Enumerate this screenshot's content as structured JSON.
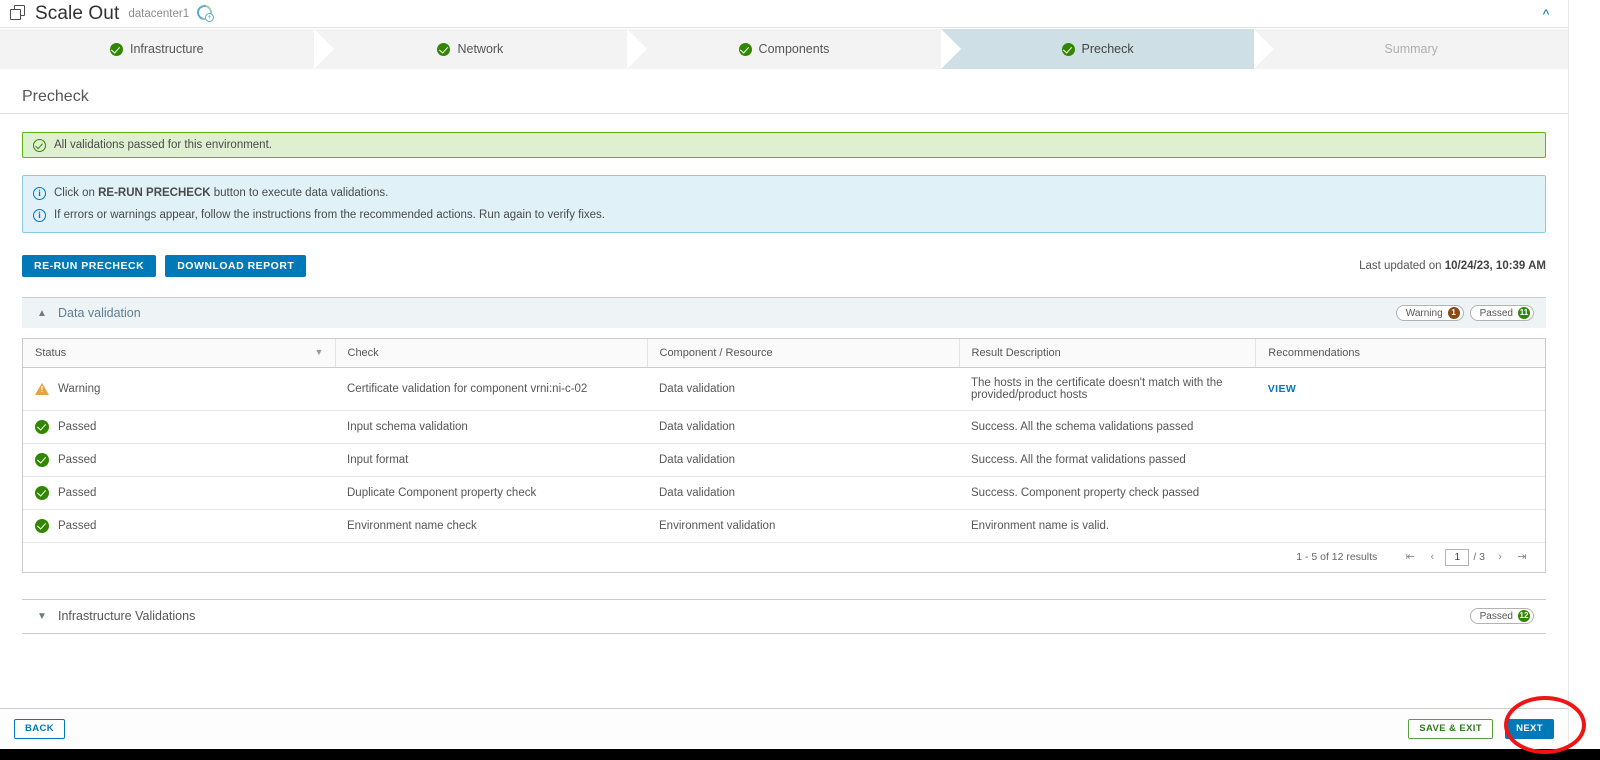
{
  "header": {
    "app_icon": "stacked-squares-icon",
    "title": "Scale Out",
    "subtitle": "datacenter1",
    "env_icon": "environment-add-icon",
    "collapse_icon": "chevron-double-up-icon"
  },
  "stepper": {
    "steps": [
      {
        "label": "Infrastructure",
        "state": "complete"
      },
      {
        "label": "Network",
        "state": "complete"
      },
      {
        "label": "Components",
        "state": "complete"
      },
      {
        "label": "Precheck",
        "state": "active"
      },
      {
        "label": "Summary",
        "state": "disabled"
      }
    ]
  },
  "page": {
    "title": "Precheck"
  },
  "alerts": {
    "success": {
      "icon": "check-circle-icon",
      "text": "All validations passed for this environment."
    },
    "info": {
      "icon": "info-circle-icon",
      "line1_prefix": "Click on ",
      "line1_strong": "RE-RUN PRECHECK",
      "line1_suffix": " button to execute data validations.",
      "line2": "If errors or warnings appear, follow the instructions from the recommended actions. Run again to verify fixes."
    }
  },
  "actions": {
    "rerun_label": "RE-RUN PRECHECK",
    "download_label": "DOWNLOAD REPORT",
    "last_updated_prefix": "Last updated on ",
    "last_updated_value": "10/24/23, 10:39 AM"
  },
  "data_validation": {
    "caret_icon": "chevron-up-icon",
    "title": "Data validation",
    "badges": [
      {
        "label": "Warning",
        "count": "1",
        "tone": "warn"
      },
      {
        "label": "Passed",
        "count": "11",
        "tone": "pass"
      }
    ],
    "columns": [
      "Status",
      "Check",
      "Component / Resource",
      "Result Description",
      "Recommendations"
    ],
    "filter_icon": "funnel-filter-icon",
    "rows": [
      {
        "status": "Warning",
        "status_icon": "warning-triangle-icon",
        "check": "Certificate validation for component vrni:ni-c-02",
        "component": "Data validation",
        "result": "The hosts in the certificate doesn't match with the provided/product hosts",
        "recommendation": "VIEW"
      },
      {
        "status": "Passed",
        "status_icon": "success-check-icon",
        "check": "Input schema validation",
        "component": "Data validation",
        "result": "Success. All the schema validations passed",
        "recommendation": ""
      },
      {
        "status": "Passed",
        "status_icon": "success-check-icon",
        "check": "Input format",
        "component": "Data validation",
        "result": "Success. All the format validations passed",
        "recommendation": ""
      },
      {
        "status": "Passed",
        "status_icon": "success-check-icon",
        "check": "Duplicate Component property check",
        "component": "Data validation",
        "result": "Success. Component property check passed",
        "recommendation": ""
      },
      {
        "status": "Passed",
        "status_icon": "success-check-icon",
        "check": "Environment name check",
        "component": "Environment validation",
        "result": "Environment name is valid.",
        "recommendation": ""
      }
    ],
    "pager": {
      "results_label": "1 - 5 of 12 results",
      "first_icon": "first-page-icon",
      "prev_icon": "prev-page-icon",
      "current_page": "1",
      "total_pages": "/ 3",
      "next_icon": "next-page-icon",
      "last_icon": "last-page-icon"
    }
  },
  "infrastructure_validations": {
    "caret_icon": "chevron-down-icon",
    "title": "Infrastructure Validations",
    "badge": {
      "label": "Passed",
      "count": "12",
      "tone": "pass"
    }
  },
  "footer": {
    "back_label": "BACK",
    "save_exit_label": "SAVE & EXIT",
    "next_label": "NEXT"
  },
  "colors": {
    "accent": "#0079b8",
    "success": "#318700",
    "warning": "#e5a33c",
    "warning_badge": "#8a4a13",
    "active_step": "#cfdfe6",
    "highlight": "#f01414"
  }
}
